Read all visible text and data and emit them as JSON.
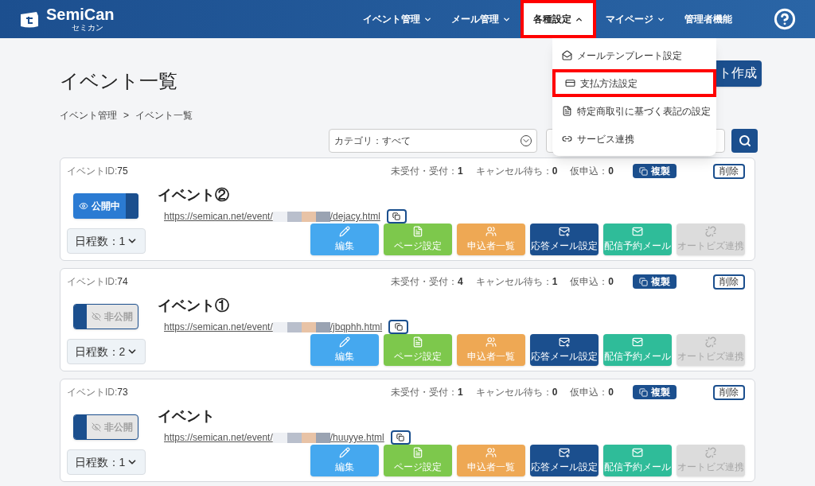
{
  "header": {
    "logo": "SemiCan",
    "logo_sub": "セミカン",
    "nav": [
      {
        "label": "イベント管理",
        "dropdown": true,
        "expanded": false,
        "highlighted": false
      },
      {
        "label": "メール管理",
        "dropdown": true,
        "expanded": false,
        "highlighted": false
      },
      {
        "label": "各種設定",
        "dropdown": true,
        "expanded": true,
        "highlighted": true
      },
      {
        "label": "マイページ",
        "dropdown": true,
        "expanded": false,
        "highlighted": false
      },
      {
        "label": "管理者機能",
        "dropdown": false,
        "expanded": false,
        "highlighted": false
      }
    ]
  },
  "settings_menu": [
    {
      "kind": "mail-template",
      "label": "メールテンプレート設定",
      "highlighted": false
    },
    {
      "kind": "payment",
      "label": "支払方法設定",
      "highlighted": true
    },
    {
      "kind": "document",
      "label": "特定商取引に基づく表記の設定",
      "highlighted": false
    },
    {
      "kind": "link",
      "label": "サービス連携",
      "highlighted": false
    }
  ],
  "page": {
    "title": "イベント一覧",
    "create_button": "ト作成",
    "breadcrumb": [
      "イベント管理",
      "イベント一覧"
    ],
    "breadcrumb_separator": ">"
  },
  "filter": {
    "category": "カテゴリ：すべて"
  },
  "events": [
    {
      "id_label": "イベントID:",
      "id": "75",
      "stats": [
        {
          "label": "未受付・受付：",
          "value": "1"
        },
        {
          "label": "キャンセル待ち：",
          "value": "0"
        },
        {
          "label": "仮申込：",
          "value": "0"
        }
      ],
      "duplicate": "複製",
      "delete": "削除",
      "published": true,
      "status": "公開中",
      "title": "イベント②",
      "url_prefix": "https://semican.net/event/",
      "url_suffix": "/dejacy.html",
      "days": "日程数：1",
      "actions": [
        {
          "kind": "edit",
          "label": "編集",
          "disabled": false
        },
        {
          "kind": "page",
          "label": "ページ設定",
          "disabled": false
        },
        {
          "kind": "applicants",
          "label": "申込者一覧",
          "disabled": false
        },
        {
          "kind": "reply-mail",
          "label": "応答メール設定",
          "disabled": false
        },
        {
          "kind": "scheduled-mail",
          "label": "配信予約メール",
          "disabled": false
        },
        {
          "kind": "autobiz",
          "label": "オートビズ連携",
          "disabled": true
        }
      ]
    },
    {
      "id_label": "イベントID:",
      "id": "74",
      "stats": [
        {
          "label": "未受付・受付：",
          "value": "4"
        },
        {
          "label": "キャンセル待ち：",
          "value": "1"
        },
        {
          "label": "仮申込：",
          "value": "0"
        }
      ],
      "duplicate": "複製",
      "delete": "削除",
      "published": false,
      "status": "非公開",
      "title": "イベント①",
      "url_prefix": "https://semican.net/event/",
      "url_suffix": "/jbqphh.html",
      "days": "日程数：2",
      "actions": [
        {
          "kind": "edit",
          "label": "編集",
          "disabled": false
        },
        {
          "kind": "page",
          "label": "ページ設定",
          "disabled": false
        },
        {
          "kind": "applicants",
          "label": "申込者一覧",
          "disabled": false
        },
        {
          "kind": "reply-mail",
          "label": "応答メール設定",
          "disabled": false
        },
        {
          "kind": "scheduled-mail",
          "label": "配信予約メール",
          "disabled": false
        },
        {
          "kind": "autobiz",
          "label": "オートビズ連携",
          "disabled": true
        }
      ]
    },
    {
      "id_label": "イベントID:",
      "id": "73",
      "stats": [
        {
          "label": "未受付・受付：",
          "value": "1"
        },
        {
          "label": "キャンセル待ち：",
          "value": "0"
        },
        {
          "label": "仮申込：",
          "value": "0"
        }
      ],
      "duplicate": "複製",
      "delete": "削除",
      "published": false,
      "status": "非公開",
      "title": "イベント",
      "url_prefix": "https://semican.net/event/",
      "url_suffix": "/huuyye.html",
      "days": "日程数：1",
      "actions": [
        {
          "kind": "edit",
          "label": "編集",
          "disabled": false
        },
        {
          "kind": "page",
          "label": "ページ設定",
          "disabled": false
        },
        {
          "kind": "applicants",
          "label": "申込者一覧",
          "disabled": false
        },
        {
          "kind": "reply-mail",
          "label": "応答メール設定",
          "disabled": false
        },
        {
          "kind": "scheduled-mail",
          "label": "配信予約メール",
          "disabled": false
        },
        {
          "kind": "autobiz",
          "label": "オートビズ連携",
          "disabled": true
        }
      ]
    }
  ]
}
